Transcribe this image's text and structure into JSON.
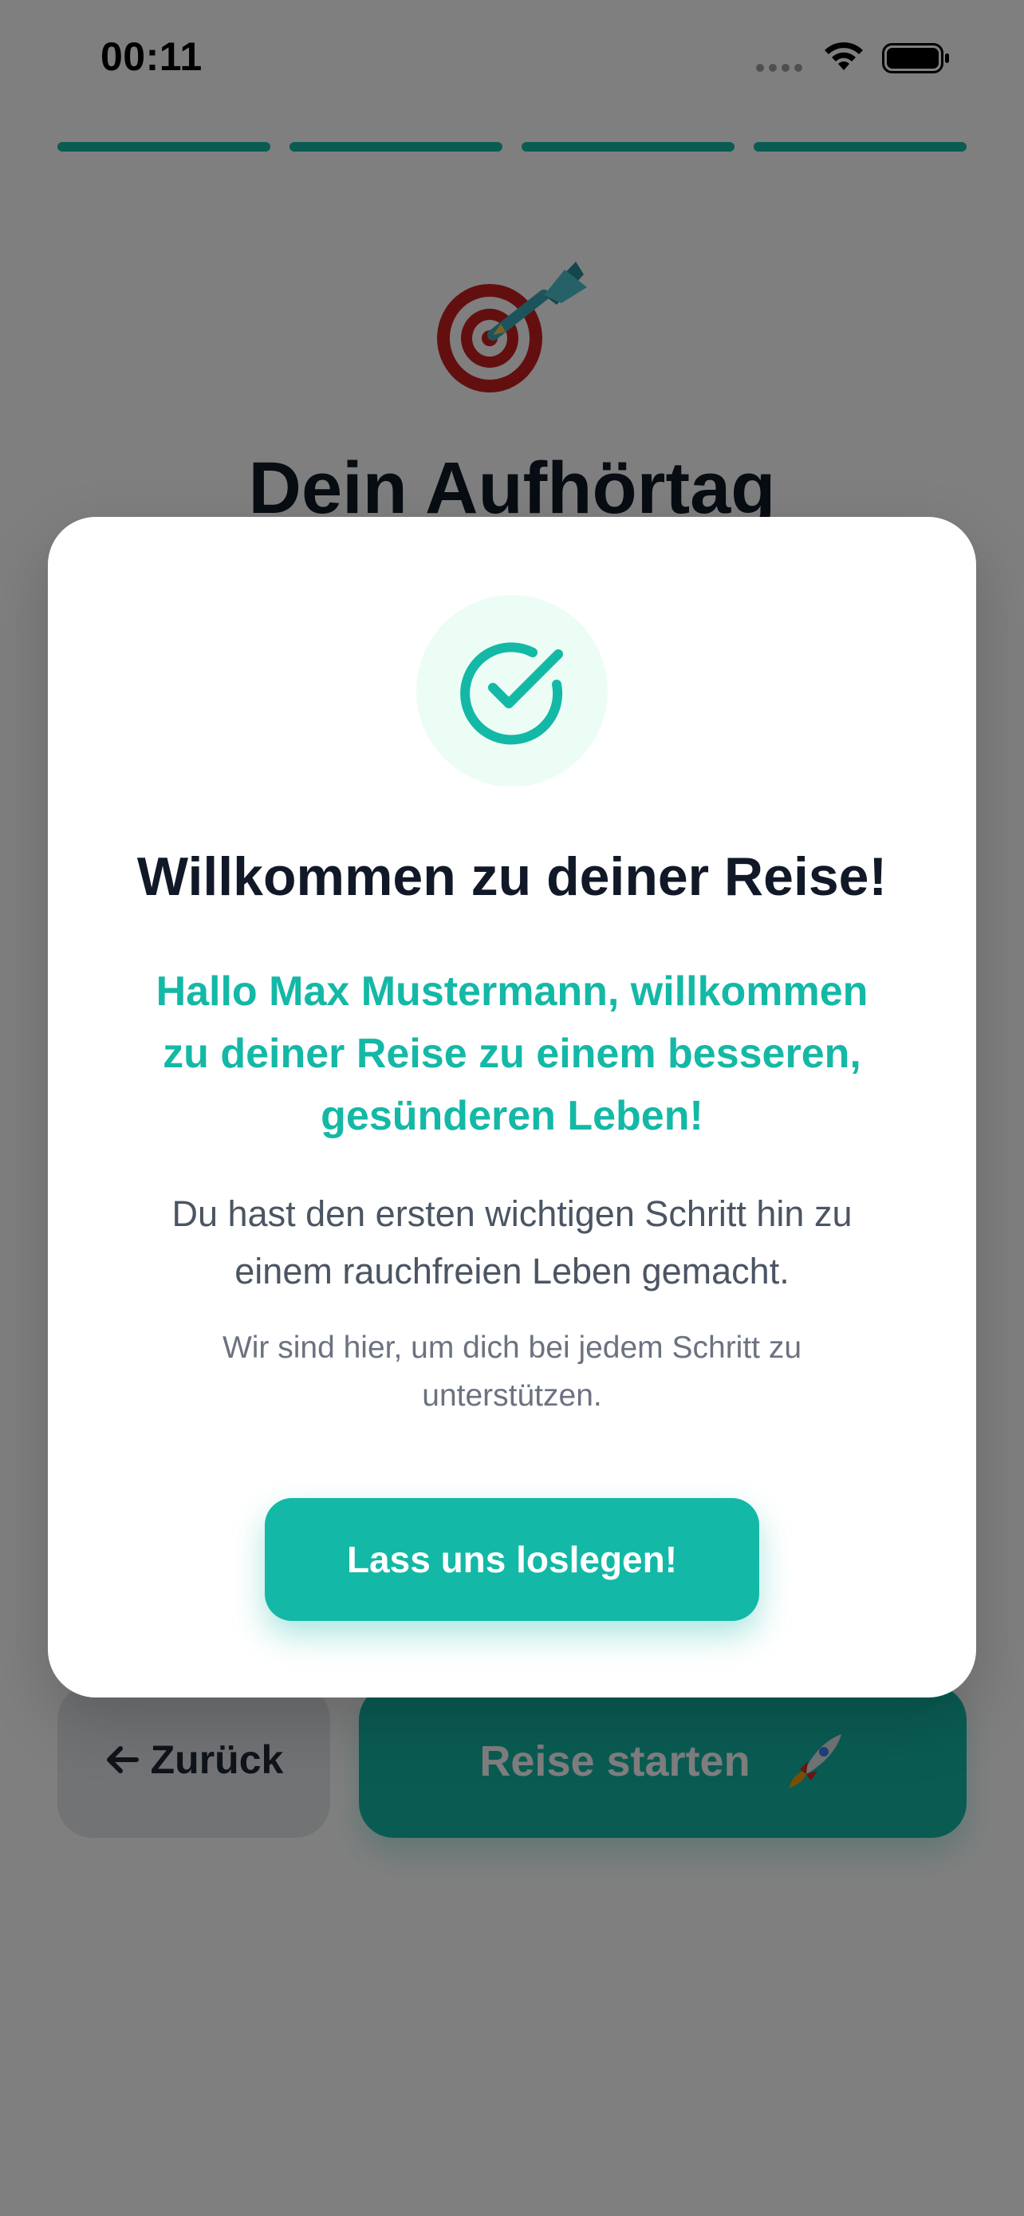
{
  "status_bar": {
    "time": "00:11"
  },
  "background": {
    "title": "Dein Aufhörtag",
    "back_label": "Zurück",
    "start_label": "Reise starten"
  },
  "modal": {
    "title": "Willkommen zu deiner Reise!",
    "greeting": "Hallo Max Mustermann, willkommen zu deiner Reise zu einem besseren, gesünderen Leben!",
    "body": "Du hast den ersten wichtigen Schritt hin zu einem rauchfreien Leben gemacht.",
    "note": "Wir sind hier, um dich bei jedem Schritt zu unterstützen.",
    "cta_label": "Lass uns loslegen!"
  },
  "progress": {
    "segments_total": 4,
    "segments_completed": 4
  },
  "icons": {
    "status": [
      "signal-icon",
      "wifi-icon",
      "battery-icon"
    ],
    "hero": "target-dart-icon",
    "modal": "check-circle-icon",
    "back": "arrow-left-icon",
    "start": "rocket-icon"
  },
  "colors": {
    "accent": "#14b8a6",
    "accent_light": "#ecfdf5",
    "title_text": "#111827",
    "body_text": "#4b5563",
    "muted_text": "#6b7280",
    "overlay": "rgba(0,0,0,0.5)"
  }
}
